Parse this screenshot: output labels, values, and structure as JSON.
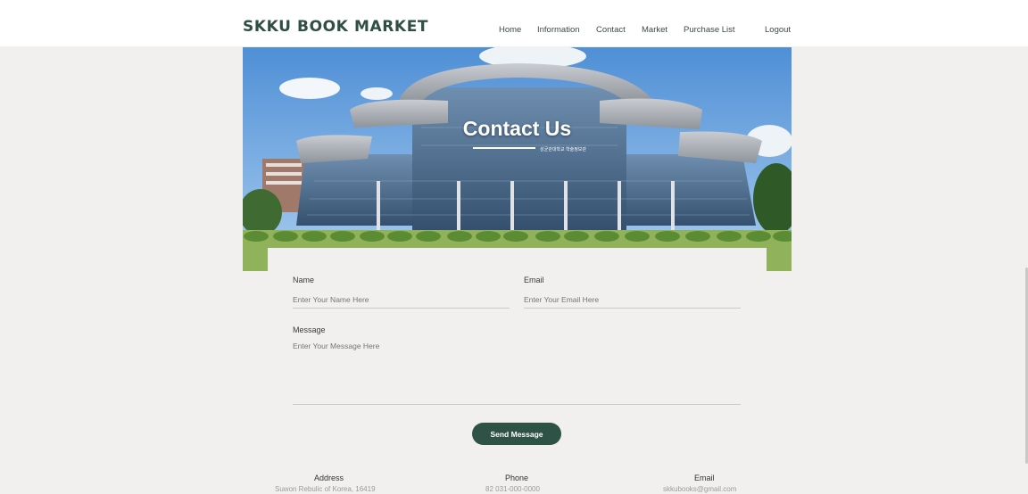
{
  "header": {
    "brand": "SKKU BOOK MARKET",
    "nav": [
      "Home",
      "Information",
      "Contact",
      "Market",
      "Purchase List",
      "Logout"
    ]
  },
  "hero": {
    "title": "Contact Us",
    "subtitle": "성균관대학교 학술정보관"
  },
  "form": {
    "name_label": "Name",
    "name_placeholder": "Enter Your Name Here",
    "email_label": "Email",
    "email_placeholder": "Enter Your Email Here",
    "message_label": "Message",
    "message_placeholder": "Enter Your Message Here",
    "send_label": "Send Message"
  },
  "footer": {
    "address_label": "Address",
    "address_value": "Suwon Rebulic of Korea, 16419",
    "phone_label": "Phone",
    "phone_value": "82 031-000-0000",
    "email_label": "Email",
    "email_value": "skkubooks@gmail.com"
  },
  "colors": {
    "brand": "#2f4f44",
    "button": "#2f5247",
    "page_bg": "#f1f0ee"
  }
}
